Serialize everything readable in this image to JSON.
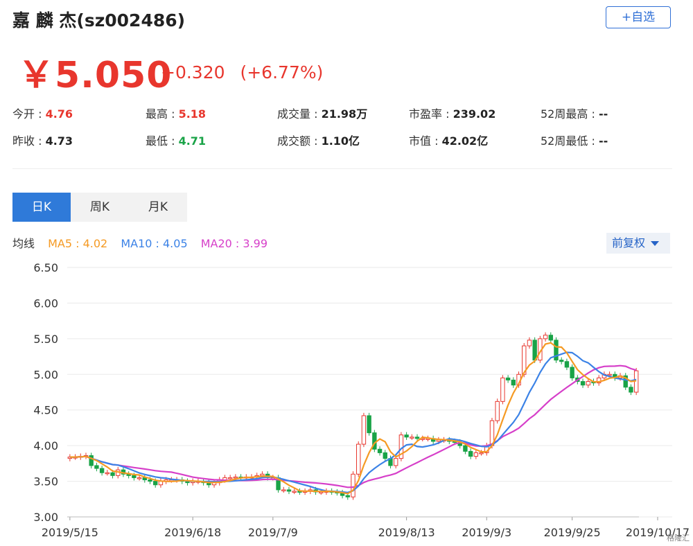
{
  "header": {
    "title": "嘉 麟 杰(sz002486)",
    "add_label": "+自选"
  },
  "quote": {
    "price": "￥5.050",
    "change": "+0.320",
    "change_pct": "(+6.77%)"
  },
  "stats": [
    {
      "label": "今开 : ",
      "value": "4.76",
      "color": "red"
    },
    {
      "label": "最高 : ",
      "value": "5.18",
      "color": "red"
    },
    {
      "label": "成交量 : ",
      "value": "21.98万",
      "color": ""
    },
    {
      "label": "市盈率 : ",
      "value": "239.02",
      "color": ""
    },
    {
      "label": "52周最高 : ",
      "value": "--",
      "color": ""
    },
    {
      "label": "昨收 : ",
      "value": "4.73",
      "color": ""
    },
    {
      "label": "最低 : ",
      "value": "4.71",
      "color": "green"
    },
    {
      "label": "成交额 : ",
      "value": "1.10亿",
      "color": ""
    },
    {
      "label": "市值 : ",
      "value": "42.02亿",
      "color": ""
    },
    {
      "label": "52周最低 : ",
      "value": "--",
      "color": ""
    }
  ],
  "tabs": [
    "日K",
    "周K",
    "月K"
  ],
  "ma": {
    "label": "均线",
    "ma5": "MA5 : 4.02",
    "ma10": "MA10 : 4.05",
    "ma20": "MA20 : 3.99"
  },
  "adjust_label": "前复权",
  "watermark": "格隆汇",
  "colors": {
    "up": "#e8362d",
    "down": "#19a347",
    "ma5": "#f59a23",
    "ma10": "#3b82e6",
    "ma20": "#d63fc9",
    "accent": "#2f7ad9"
  },
  "chart_data": {
    "type": "candlestick",
    "ylim": [
      3.0,
      6.5
    ],
    "yticks": [
      "6.50",
      "6.00",
      "5.50",
      "5.00",
      "4.50",
      "4.00",
      "3.50",
      "3.00"
    ],
    "xticks": [
      "2019/5/15",
      "2019/6/18",
      "2019/7/9",
      "2019/8/13",
      "2019/9/3",
      "2019/9/25",
      "2019/10/17"
    ],
    "xtick_index": [
      0,
      23,
      38,
      63,
      78,
      94,
      110
    ],
    "close": [
      3.84,
      3.84,
      3.85,
      3.86,
      3.72,
      3.68,
      3.62,
      3.62,
      3.58,
      3.66,
      3.6,
      3.58,
      3.55,
      3.55,
      3.52,
      3.5,
      3.45,
      3.5,
      3.52,
      3.52,
      3.52,
      3.5,
      3.48,
      3.5,
      3.5,
      3.48,
      3.45,
      3.48,
      3.52,
      3.55,
      3.55,
      3.56,
      3.55,
      3.56,
      3.56,
      3.58,
      3.6,
      3.55,
      3.55,
      3.38,
      3.38,
      3.36,
      3.36,
      3.35,
      3.36,
      3.38,
      3.35,
      3.35,
      3.36,
      3.35,
      3.34,
      3.3,
      3.28,
      3.6,
      4.02,
      4.42,
      4.18,
      3.95,
      3.9,
      3.82,
      3.72,
      3.82,
      4.15,
      4.12,
      4.12,
      4.1,
      4.1,
      4.1,
      4.06,
      4.08,
      4.08,
      4.06,
      4.05,
      4.0,
      3.92,
      3.85,
      3.9,
      3.9,
      4.0,
      4.35,
      4.62,
      4.95,
      4.92,
      4.85,
      5.0,
      5.4,
      5.48,
      5.2,
      5.5,
      5.55,
      5.48,
      5.2,
      5.18,
      5.1,
      4.95,
      4.9,
      4.85,
      4.9,
      4.88,
      4.95,
      5.0,
      5.0,
      4.95,
      4.98,
      4.82,
      4.75,
      5.05
    ],
    "ma5_end": "4.02",
    "ma10_end": "4.05",
    "ma20_end": "3.99"
  }
}
